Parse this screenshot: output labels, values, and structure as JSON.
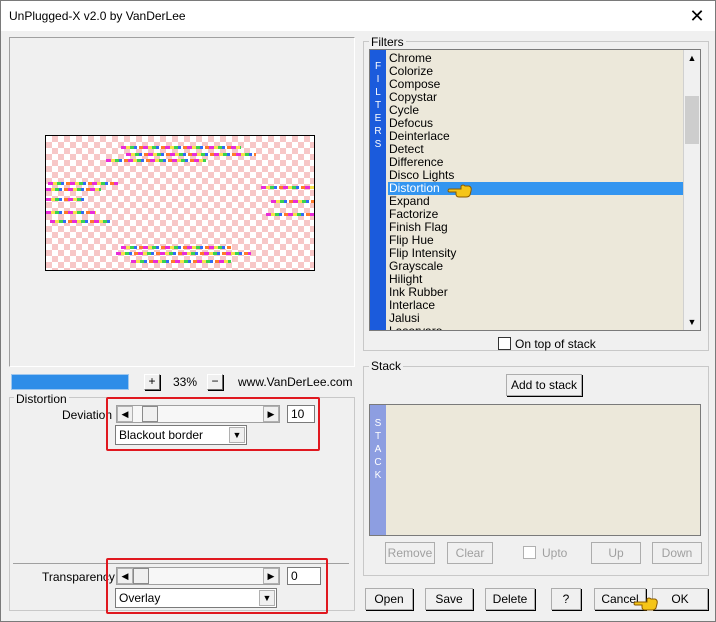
{
  "window": {
    "title": "UnPlugged-X v2.0 by VanDerLee",
    "close_icon": "close-icon"
  },
  "preview": {
    "zoom_label": "33%",
    "zoom_in": "+",
    "zoom_out": "−",
    "website": "www.VanDerLee.com",
    "progress": 1.0
  },
  "distortion": {
    "group_label": "Distortion",
    "deviation_label": "Deviation",
    "deviation_value": "10",
    "mode_selected": "Blackout border"
  },
  "transparency": {
    "label": "Transparency",
    "value": "0",
    "blend_selected": "Overlay"
  },
  "filters": {
    "group_label": "Filters",
    "band_text": "FILTERS",
    "items": [
      "Chrome",
      "Colorize",
      "Compose",
      "Copystar",
      "Cycle",
      "Defocus",
      "Deinterlace",
      "Detect",
      "Difference",
      "Disco Lights",
      "Distortion",
      "Expand",
      "Factorize",
      "Finish Flag",
      "Flip Hue",
      "Flip Intensity",
      "Grayscale",
      "Hilight",
      "Ink Rubber",
      "Interlace",
      "Jalusi",
      "Lasorvaro"
    ],
    "selected_index": 10,
    "on_top_label": "On top of stack"
  },
  "stack": {
    "group_label": "Stack",
    "band_text": "STACK",
    "add_label": "Add to stack",
    "remove_label": "Remove",
    "clear_label": "Clear",
    "upto_label": "Upto",
    "up_label": "Up",
    "down_label": "Down"
  },
  "footer": {
    "open_label": "Open",
    "save_label": "Save",
    "delete_label": "Delete",
    "help_label": "?",
    "cancel_label": "Cancel",
    "ok_label": "OK"
  },
  "colors": {
    "accent": "#3395f0",
    "band": "#1b5bdc",
    "highlight": "#e0181f",
    "list_bg": "#ece8da"
  }
}
